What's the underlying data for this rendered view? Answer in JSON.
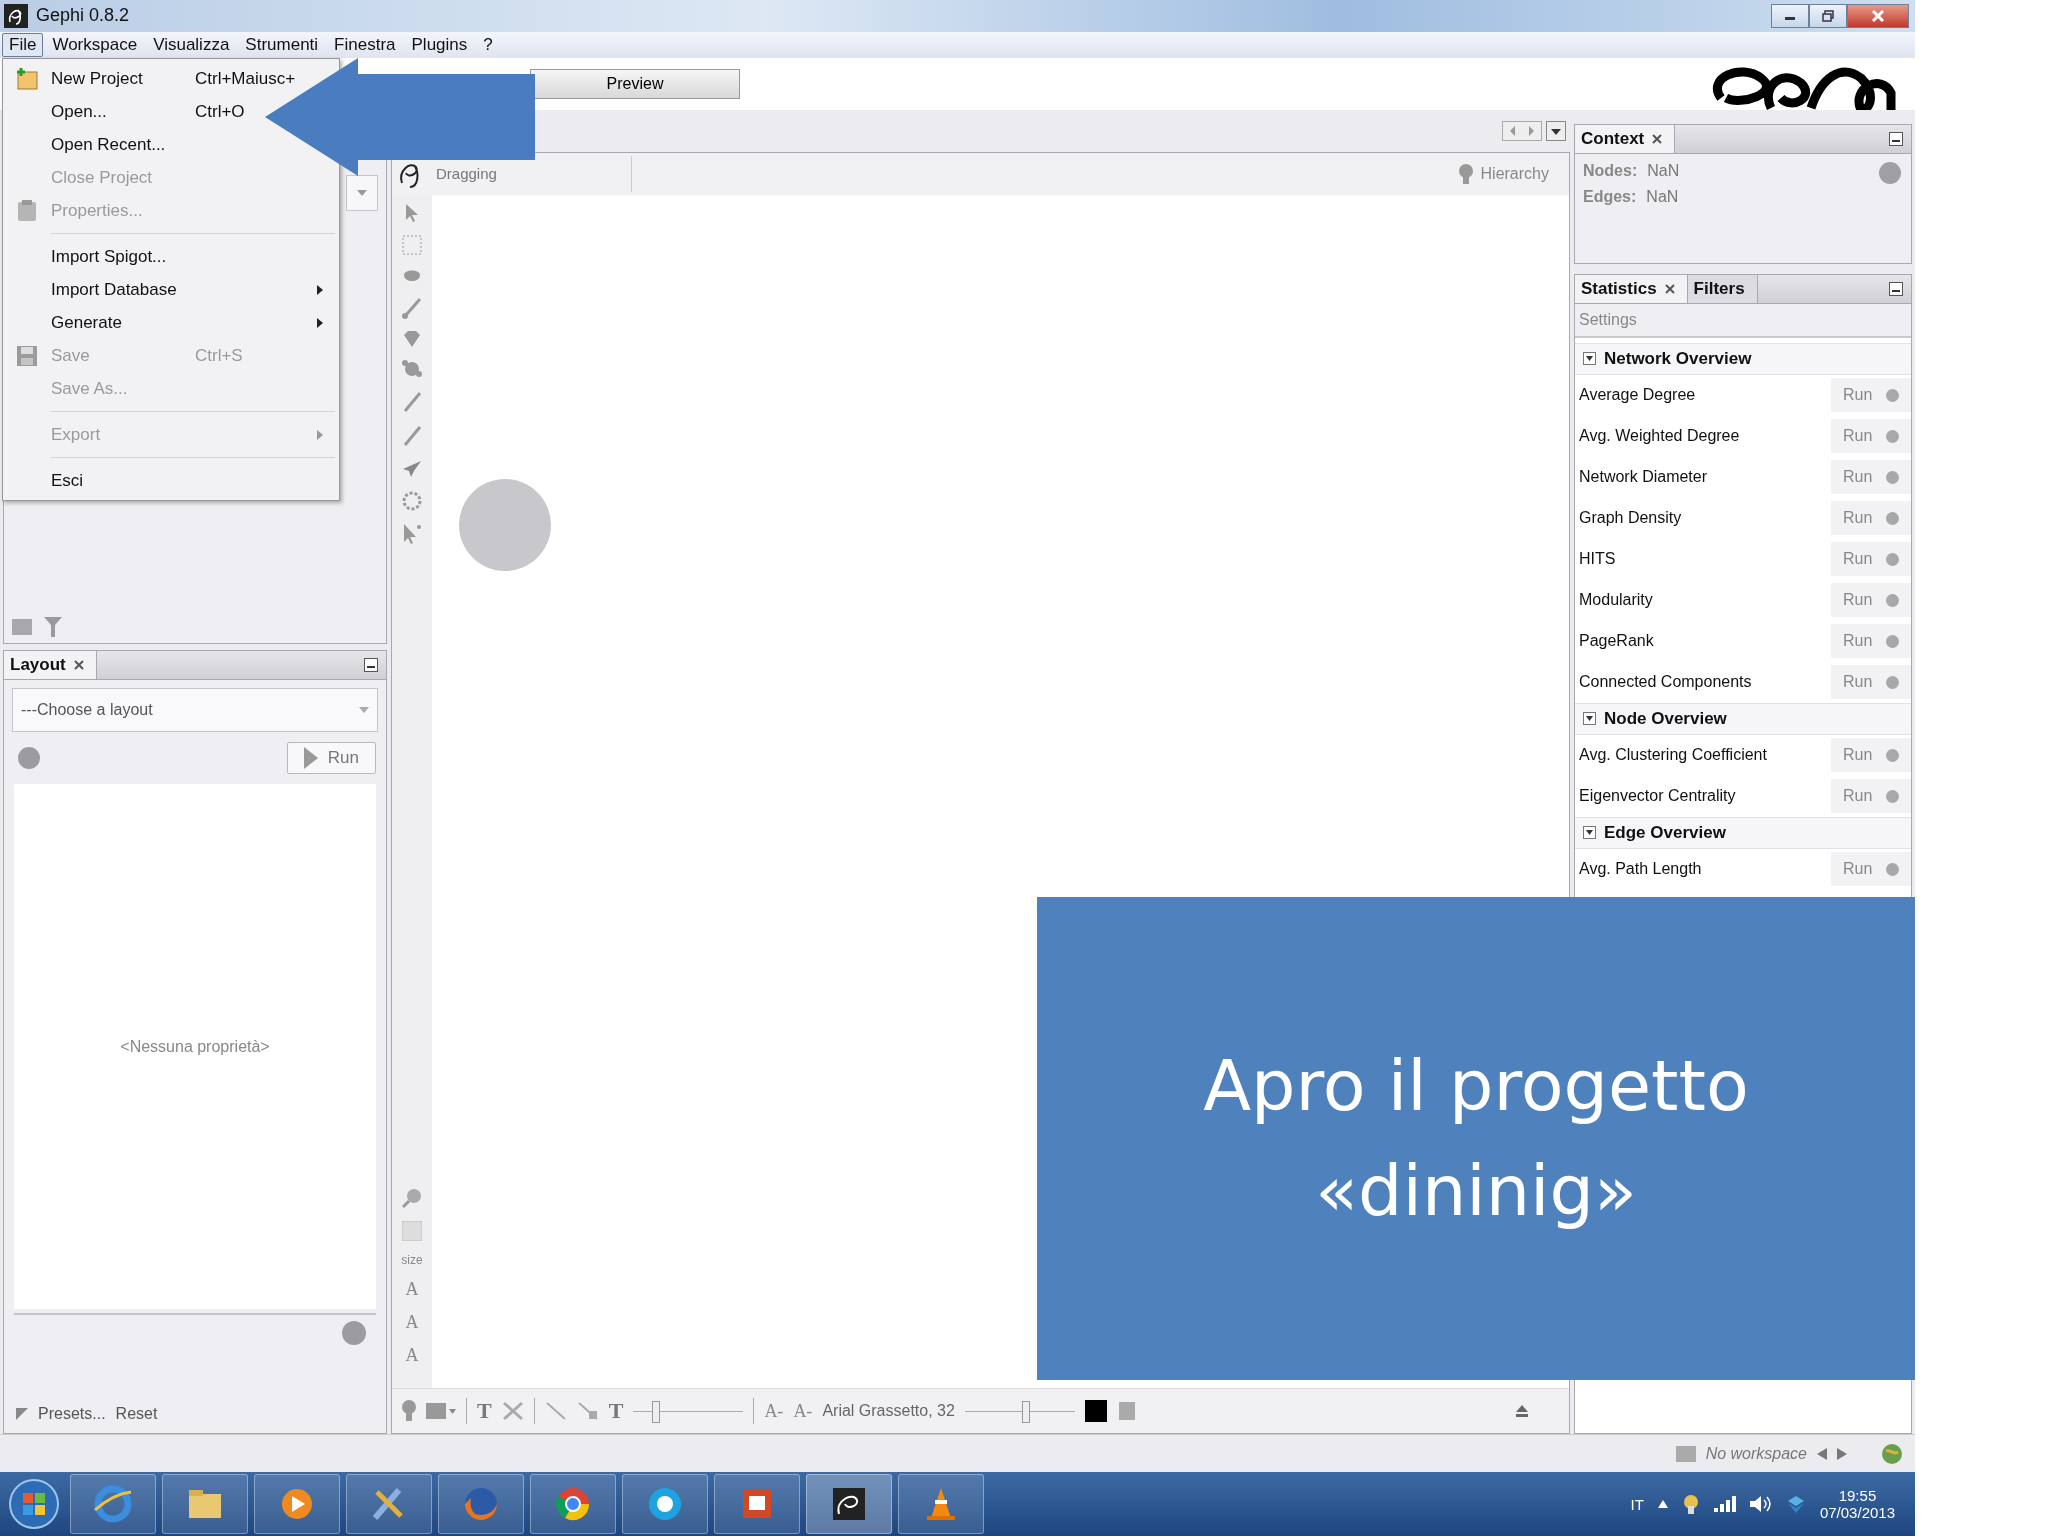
{
  "window": {
    "title": "Gephi 0.8.2"
  },
  "menu_bar": [
    {
      "label": "File",
      "selected": true
    },
    {
      "label": "Workspace",
      "selected": false
    },
    {
      "label": "Visualizza",
      "selected": false
    },
    {
      "label": "Strumenti",
      "selected": false
    },
    {
      "label": "Finestra",
      "selected": false
    },
    {
      "label": "Plugins",
      "selected": false
    },
    {
      "label": "?",
      "selected": false
    }
  ],
  "file_menu": [
    [
      {
        "label": "New Project",
        "shortcut": "Ctrl+Maiusc+",
        "disabled": false,
        "submenu": false,
        "kind": "new"
      },
      {
        "label": "Open...",
        "shortcut": "Ctrl+O",
        "disabled": false,
        "submenu": false
      },
      {
        "label": "Open Recent...",
        "disabled": false,
        "submenu": false
      },
      {
        "label": "Close Project",
        "disabled": true,
        "submenu": false
      },
      {
        "label": "Properties...",
        "disabled": true,
        "submenu": false,
        "kind": "properties"
      }
    ],
    [
      {
        "label": "Import Spigot...",
        "disabled": false,
        "submenu": false
      },
      {
        "label": "Import Database",
        "disabled": false,
        "submenu": true
      },
      {
        "label": "Generate",
        "disabled": false,
        "submenu": true
      },
      {
        "label": "Save",
        "shortcut": "Ctrl+S",
        "disabled": true,
        "submenu": false,
        "kind": "save"
      },
      {
        "label": "Save As...",
        "disabled": true,
        "submenu": false
      }
    ],
    [
      {
        "label": "Export",
        "disabled": true,
        "submenu": true
      }
    ],
    [
      {
        "label": "Esci",
        "disabled": false,
        "submenu": false
      }
    ]
  ],
  "toolbar": {
    "preview_button": "Preview"
  },
  "graph_view": {
    "tool": "Dragging",
    "hierarchy": "Hierarchy",
    "size_label": "size",
    "text_tools": [
      "A",
      "A",
      "A"
    ],
    "bottom_text_buttons": [
      "T",
      "T"
    ],
    "font_buttons": [
      "A-",
      "A-"
    ],
    "font_label": "Arial Grassetto, 32",
    "sliders": [
      {
        "level": 0.2
      },
      {
        "level": 0.55
      }
    ]
  },
  "context": {
    "title": "Context",
    "stats": [
      {
        "label": "Nodes:",
        "value": "NaN"
      },
      {
        "label": "Edges:",
        "value": "NaN"
      }
    ]
  },
  "stats_panel": {
    "tabs": [
      {
        "label": "Statistics",
        "selected": true
      },
      {
        "label": "Filters",
        "selected": false
      }
    ],
    "settings": "Settings",
    "sections": [
      {
        "title": "Network Overview",
        "expanded": true,
        "items": [
          {
            "name": "Average Degree",
            "action": "Run"
          },
          {
            "name": "Avg. Weighted Degree",
            "action": "Run"
          },
          {
            "name": "Network Diameter",
            "action": "Run"
          },
          {
            "name": "Graph Density",
            "action": "Run"
          },
          {
            "name": "HITS",
            "action": "Run"
          },
          {
            "name": "Modularity",
            "action": "Run"
          },
          {
            "name": "PageRank",
            "action": "Run"
          },
          {
            "name": "Connected Components",
            "action": "Run"
          }
        ]
      },
      {
        "title": "Node Overview",
        "expanded": true,
        "items": [
          {
            "name": "Avg. Clustering Coefficient",
            "action": "Run"
          },
          {
            "name": "Eigenvector Centrality",
            "action": "Run"
          }
        ]
      },
      {
        "title": "Edge Overview",
        "expanded": true,
        "items": [
          {
            "name": "Avg. Path Length",
            "action": "Run"
          }
        ]
      }
    ]
  },
  "layout_panel": {
    "title": "Layout",
    "select": "---Choose a layout",
    "run": "Run",
    "empty": "<Nessuna proprietà>",
    "presets": "Presets...",
    "reset": "Reset"
  },
  "status_bar": {
    "workspace": "No workspace"
  },
  "taskbar": {
    "language": "IT",
    "time": "19:55",
    "date": "07/03/2013"
  },
  "caption": "Apro il progetto «dininig»"
}
